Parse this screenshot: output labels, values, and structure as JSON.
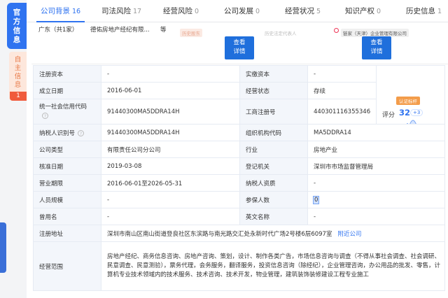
{
  "rail": {
    "main_label": "官方信息",
    "sub_label": "自主信息",
    "sub_badge": "1"
  },
  "tabs": [
    {
      "label": "公司背景",
      "count": "16",
      "active": true
    },
    {
      "label": "司法风险",
      "count": "17"
    },
    {
      "label": "经营风险",
      "count": "0"
    },
    {
      "label": "公司发展",
      "count": "0"
    },
    {
      "label": "经营状况",
      "count": "5"
    },
    {
      "label": "知识产权",
      "count": "0"
    },
    {
      "label": "历史信息",
      "count": "1"
    }
  ],
  "relation": {
    "region": "广东（共1家）",
    "company": "德佑房地产经纪有限...",
    "more": "等",
    "stamp1": "历史股东",
    "stamp2": "历史法定代表人",
    "stamp3": "链家（天津）企业管理有限公司",
    "btn1": "查看详情",
    "btn2": "查看详情"
  },
  "score": {
    "badge": "认证标杆",
    "label": "评分",
    "value": "32",
    "delta": "+3"
  },
  "rows": {
    "reg_capital_l": "注册资本",
    "reg_capital_v": "-",
    "paid_capital_l": "实缴资本",
    "paid_capital_v": "-",
    "est_date_l": "成立日期",
    "est_date_v": "2016-06-01",
    "status_l": "经营状态",
    "status_v": "存续",
    "credit_code_l": "统一社会信用代码",
    "credit_code_v": "91440300MA5DDRA14H",
    "biz_reg_no_l": "工商注册号",
    "biz_reg_no_v": "440301116355346",
    "taxpayer_id_l": "纳税人识别号",
    "taxpayer_id_v": "91440300MA5DDRA14H",
    "org_code_l": "组织机构代码",
    "org_code_v": "MA5DDRA14",
    "company_type_l": "公司类型",
    "company_type_v": "有限责任公司分公司",
    "industry_l": "行业",
    "industry_v": "房地产业",
    "approval_date_l": "核准日期",
    "approval_date_v": "2019-03-08",
    "reg_authority_l": "登记机关",
    "reg_authority_v": "深圳市市场监督管理局",
    "biz_term_l": "营业期限",
    "biz_term_v": "2016-06-01至2026-05-31",
    "taxpayer_qual_l": "纳税人资质",
    "taxpayer_qual_v": "-",
    "staff_size_l": "人员规模",
    "staff_size_v": "-",
    "insured_l": "参保人数",
    "insured_v": "0",
    "former_name_l": "曾用名",
    "former_name_v": "-",
    "english_name_l": "英文名称",
    "english_name_v": "-",
    "reg_address_l": "注册地址",
    "reg_address_v": "深圳市南山区南山街道登良社区东滨路与南光路交汇处永新时代广场2号楼6层6097室",
    "nearby_link": "附近公司",
    "biz_scope_l": "经营范围",
    "biz_scope_v": "房地产经纪、商务信息咨询、房地产咨询、策划，设计、制作各类广告，市场信息咨询与调查（不得从事社会调查、社会调研、民意调查、民意测验），票务代理，会务服务，翻译服务，投资信息咨询（除经纪），企业管理咨询，办公用品的批发、零售，计算机专业技术领域内的技术服务、技术咨询、技术开发，物业管理，建筑装饰装修建设工程专业施工"
  },
  "colors": {
    "accent": "#2f73f0",
    "label_bg": "#f3f6fb",
    "badge_red": "#f05b3c",
    "badge_orange": "#f39c4a"
  }
}
